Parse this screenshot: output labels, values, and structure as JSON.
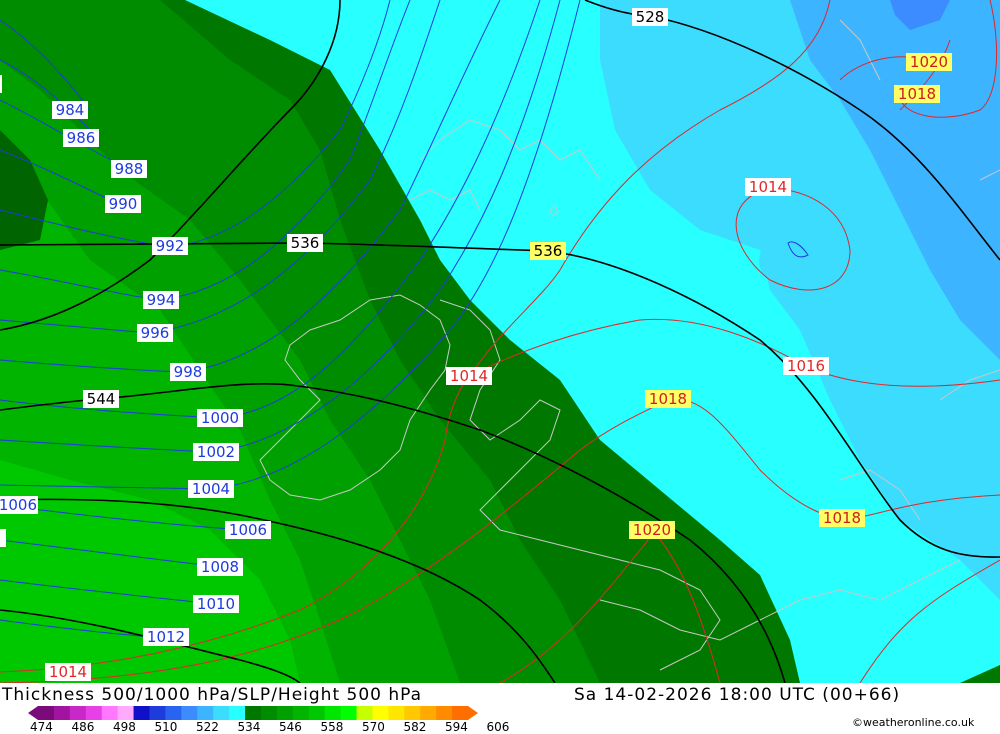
{
  "title_left": "Thickness 500/1000 hPa/SLP/Height 500 hPa",
  "title_right": "Sa 14-02-2026 18:00 UTC (00+66)",
  "credit": "©weatheronline.co.uk",
  "colorbar": {
    "ticks": [
      "474",
      "486",
      "498",
      "510",
      "522",
      "534",
      "546",
      "558",
      "570",
      "582",
      "594",
      "606"
    ],
    "colors": [
      "#7b0a7b",
      "#a014a0",
      "#c828c8",
      "#e640e6",
      "#ff78ff",
      "#ffaaff",
      "#1010c8",
      "#1e3cdc",
      "#2864f0",
      "#3c8cff",
      "#3cb4ff",
      "#3cdcff",
      "#28ffff",
      "#007800",
      "#008c00",
      "#00a000",
      "#00b400",
      "#00c800",
      "#00e600",
      "#00ff00",
      "#c8ff00",
      "#ffff00",
      "#ffe600",
      "#ffc800",
      "#ffaa00",
      "#ff8c00",
      "#ff6e00"
    ]
  },
  "colors": {
    "thickness_528_534": "#28ffff",
    "thickness_522_528": "#3cdcff",
    "thickness_516_522": "#3cb4ff",
    "thickness_510_516": "#3c8cff",
    "thickness_534_540": "#007800",
    "thickness_540_546": "#008c00",
    "thickness_546_552": "#00a000",
    "thickness_552_558": "#00b400",
    "thickness_558_564": "#00c800",
    "slp_low_isobar": "#1e3cdc",
    "slp_high_isobar": "#e02828",
    "height_500": "#000000",
    "coastline": "#c8c8c8"
  },
  "height_labels": [
    "528",
    "536",
    "536",
    "544"
  ],
  "slp_labels_low": [
    "984",
    "986",
    "988",
    "990",
    "992",
    "994",
    "996",
    "998",
    "1000",
    "1002",
    "1004",
    "1006",
    "1006",
    "1008",
    "1010",
    "1012",
    "1014"
  ],
  "slp_labels_high": [
    "1014",
    "1014",
    "1016",
    "1018",
    "1018",
    "1018",
    "1020",
    "1020",
    "1014"
  ]
}
